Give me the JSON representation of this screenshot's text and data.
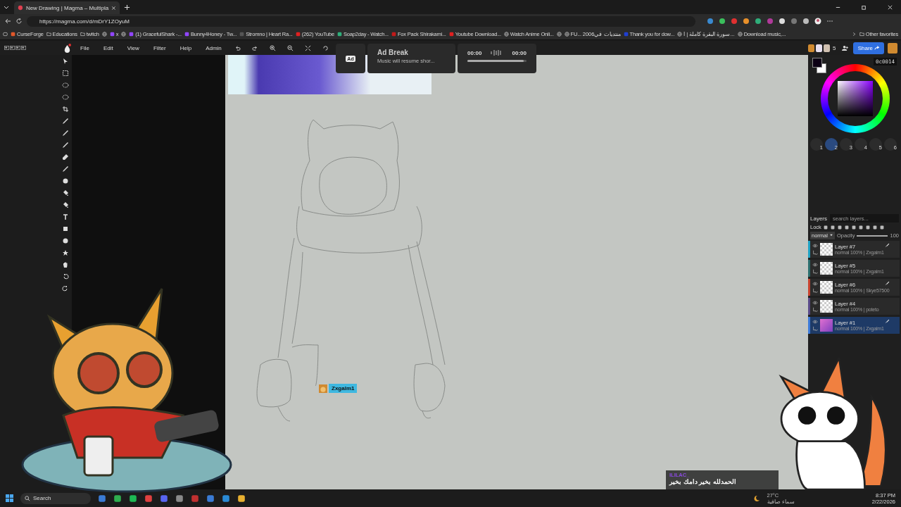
{
  "browser": {
    "tab_title": "New Drawing | Magma – Multipla",
    "url": "https://magma.com/d/mDrY1ZOyuM",
    "bookmarks": [
      {
        "kind": "app",
        "label": "CurseForge",
        "color": "#e0572a"
      },
      {
        "kind": "folder",
        "label": "Educations"
      },
      {
        "kind": "folder",
        "label": "twitch"
      },
      {
        "kind": "globe"
      },
      {
        "kind": "app",
        "label": "x",
        "color": "#9146ff"
      },
      {
        "kind": "globe"
      },
      {
        "kind": "app",
        "label": "(1) GracefulShark -...",
        "color": "#9146ff"
      },
      {
        "kind": "app",
        "label": "Bunny4Honey - Tw...",
        "color": "#9146ff"
      },
      {
        "kind": "app",
        "label": "Stromno | Heart Ra...",
        "color": "#555555"
      },
      {
        "kind": "app",
        "label": "(262) YouTube",
        "color": "#e02020"
      },
      {
        "kind": "app",
        "label": "Soap2day - Watch...",
        "color": "#2fae7a"
      },
      {
        "kind": "app",
        "label": "Fox Pack Shirakami...",
        "color": "#c21a1a"
      },
      {
        "kind": "app",
        "label": "Youtube Download...",
        "color": "#e02020"
      },
      {
        "kind": "globe",
        "label": "Watch Anime Onli..."
      },
      {
        "kind": "globe"
      },
      {
        "kind": "globe",
        "label": "FU... منتديات في2006"
      },
      {
        "kind": "app",
        "label": "Thank you for dow...",
        "color": "#1f3fd0"
      },
      {
        "kind": "globe",
        "label": "سورة البقرة كاملة | ا..."
      },
      {
        "kind": "globe",
        "label": "Download music,..."
      }
    ],
    "other_favorites": "Other favorites"
  },
  "menu": [
    "File",
    "Edit",
    "View",
    "Filter",
    "Help",
    "Admin"
  ],
  "ad": {
    "badge": "Ad",
    "title": "Ad Break",
    "subtitle": "Music will resume shor...",
    "time_start": "00:00",
    "time_end": "00:00",
    "level": 0.95
  },
  "panel": {
    "user_count": "5",
    "share": "Share",
    "hex": "0c0014",
    "brushes": [
      {
        "number": "1",
        "selected": false
      },
      {
        "number": "2",
        "selected": true
      },
      {
        "number": "3",
        "selected": false
      },
      {
        "number": "4",
        "selected": false
      },
      {
        "number": "5",
        "selected": false
      },
      {
        "number": "6",
        "selected": false
      }
    ]
  },
  "layers": {
    "title": "Layers",
    "search_placeholder": "search layers...",
    "lock": "Lock",
    "blend": "normal",
    "opacity": {
      "label": "Opacity",
      "value": "100",
      "level": 1
    },
    "items": [
      {
        "name": "Layer #7",
        "info": "normal 100% | Zxgalm1",
        "color": "#1fa3c4",
        "selected": false,
        "brush": true,
        "kind": "blank"
      },
      {
        "name": "Layer #5",
        "info": "normal 100% | Zxgalm1",
        "color": "#2b6e6e",
        "selected": false,
        "brush": false,
        "kind": "blank"
      },
      {
        "name": "Layer #6",
        "info": "normal 100% | Skye57500",
        "color": "#c9432f",
        "selected": false,
        "brush": true,
        "kind": "blank"
      },
      {
        "name": "Layer #4",
        "info": "normal 100% | poteto",
        "color": "#5a4b8a",
        "selected": false,
        "brush": false,
        "kind": "blank"
      },
      {
        "name": "Layer #1",
        "info": "normal 100% | Zxgalm1",
        "color": "#3d7bd9",
        "selected": true,
        "brush": true,
        "kind": "image"
      }
    ]
  },
  "canvas": {
    "cursor_user": "Zxgalm1"
  },
  "chat": {
    "user": "ILILAC_",
    "message": "الحمدلله بخير دامك بخير"
  },
  "taskbar": {
    "search": "Search",
    "temperature": "27°C",
    "weather": "سماء صافية",
    "time": "8:37 PM",
    "date": "2/22/2026"
  }
}
